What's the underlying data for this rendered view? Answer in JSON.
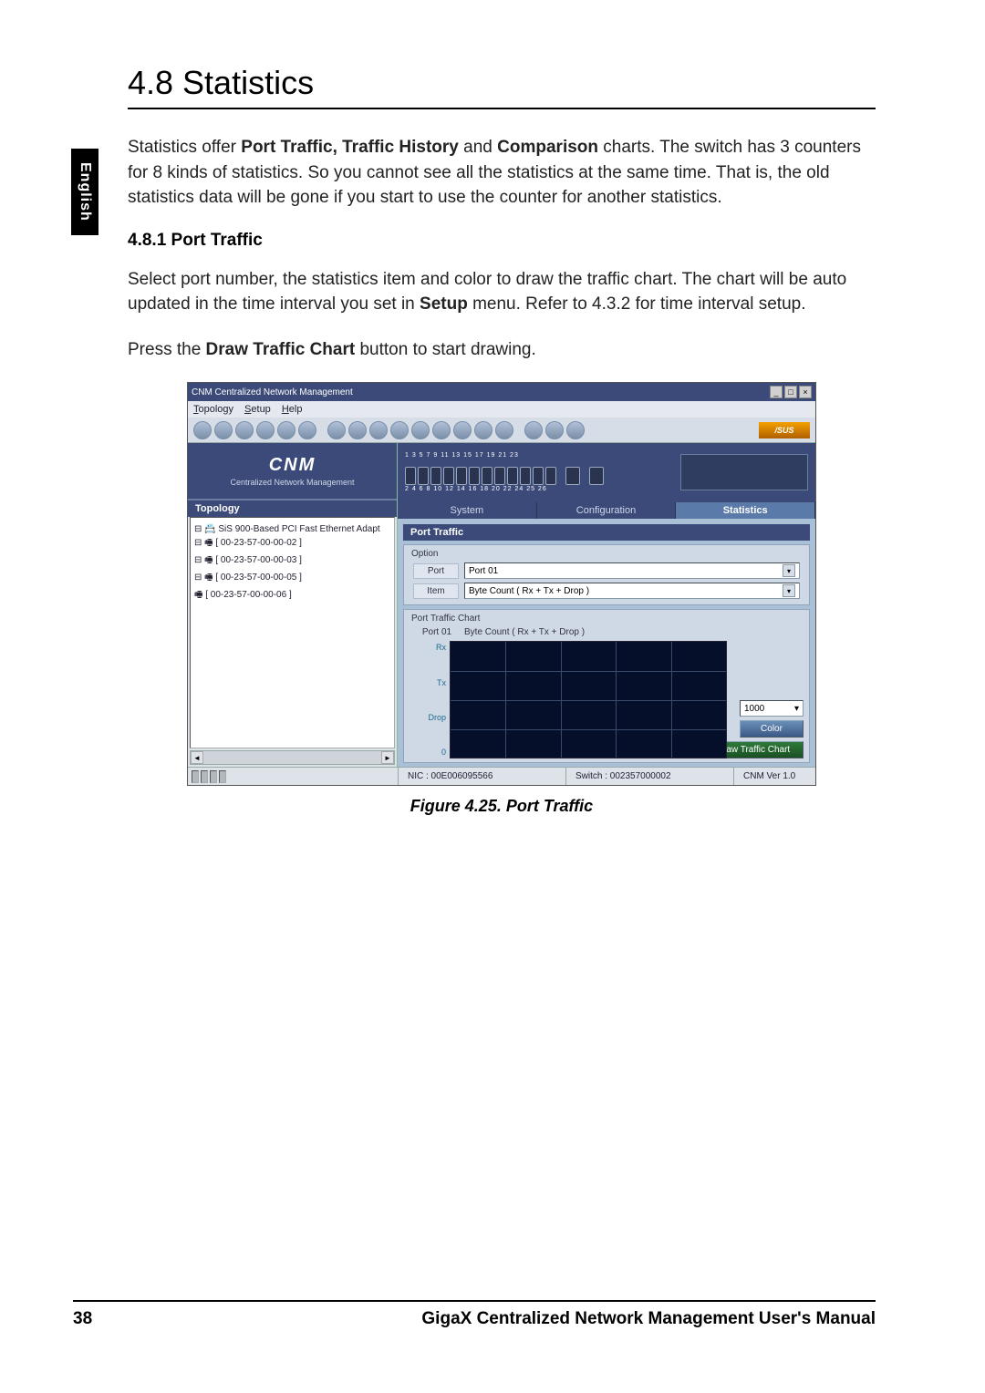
{
  "side_tab": "English",
  "h1": "4.8   Statistics",
  "intro_a": "Statistics offer ",
  "intro_b": "Port Traffic, Traffic History",
  "intro_c": " and ",
  "intro_d": "Comparison",
  "intro_e": " charts. The switch has 3 counters for 8 kinds of statistics. So you cannot see all the statistics at the same time. That is, the old statistics data will be gone if you start to use the counter for another statistics.",
  "h2": "4.8.1   Port Traffic",
  "p2_a": "Select port number, the statistics item and color to draw the traffic chart. The chart will be auto updated in the time interval you set in ",
  "p2_b": "Setup",
  "p2_c": " menu. Refer to 4.3.2 for time interval setup.",
  "p3_a": "Press the ",
  "p3_b": "Draw Traffic Chart",
  "p3_c": " button to start drawing.",
  "window": {
    "title": "CNM  Centralized Network Management",
    "min": "_",
    "max": "□",
    "close": "×",
    "menu1": "Topology",
    "menu2": "Setup",
    "menu3": "Help",
    "logo": "/SUS"
  },
  "banner": {
    "brand": "CNM",
    "sub": "Centralized Network Management"
  },
  "port_nums_top": "1   3   5   7    9  11 13 15   17 19 21 23",
  "port_nums_bot": "2   4   6   8   10 12 14 16   18 20 22 24    25         26",
  "topology_label": "Topology",
  "tree": {
    "r0": "⊟ 📇 SiS 900-Based PCI Fast Ethernet Adapt",
    "r1": "   ⊟ 🖷 [ 00-23-57-00-00-02 ]",
    "r2": "      ⊟ 🖷 [ 00-23-57-00-00-03 ]",
    "r3": "         ⊟ 🖷 [ 00-23-57-00-00-05 ]",
    "r4": "            🖷 [ 00-23-57-00-00-06 ]"
  },
  "tabs": {
    "t1": "System",
    "t2": "Configuration",
    "t3": "Statistics"
  },
  "panel": {
    "title": "Port Traffic",
    "option": "Option",
    "port_lbl": "Port",
    "port_val": "Port 01",
    "item_lbl": "Item",
    "item_val": "Byte Count ( Rx + Tx + Drop )",
    "chart_section": "Port Traffic Chart",
    "ch_port": "Port 01",
    "ch_item": "Byte Count ( Rx + Tx + Drop )",
    "rx": "Rx",
    "tx": "Tx",
    "drop": "Drop",
    "zero": "0",
    "scale": "1000",
    "color_btn": "Color",
    "draw_btn": "Draw Traffic Chart"
  },
  "status": {
    "nic": "NIC : 00E006095566",
    "switch": "Switch : 002357000002",
    "ver": "CNM Ver 1.0"
  },
  "caption": "Figure 4.25. Port Traffic",
  "footer": {
    "page": "38",
    "title": "GigaX Centralized Network Management User's Manual"
  }
}
